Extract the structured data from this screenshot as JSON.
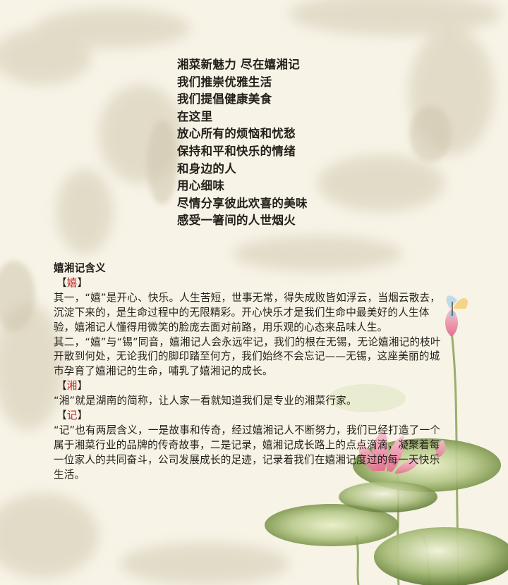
{
  "poem": {
    "lines": [
      "湘菜新魅力  尽在嬉湘记",
      "我们推崇优雅生活",
      "我们提倡健康美食",
      "在这里",
      "放心所有的烦恼和忧愁",
      "保持和平和快乐的情绪",
      "和身边的人",
      "用心细味",
      "尽情分享彼此欢喜的美味",
      "感受一箸间的人世烟火"
    ]
  },
  "article": {
    "heading": "嬉湘记含义",
    "bracket_open": "【",
    "bracket_close": "】",
    "sections": [
      {
        "key": "嬉",
        "paragraphs": [
          "其一，“嬉”是开心、快乐。人生苦短，世事无常，得失成败皆如浮云，当烟云散去，沉淀下来的，是生命过程中的无限精彩。开心快乐才是我们生命中最美好的人生体验，嬉湘记人懂得用微笑的脸庞去面对前路，用乐观的心态来品味人生。",
          "其二，“嬉”与“锡”同音，嬉湘记人会永远牢记，我们的根在无锡，无论嬉湘记的枝叶开散到何处，无论我们的脚印踏至何方，我们始终不会忘记——无锡，这座美丽的城市孕育了嬉湘记的生命，哺乳了嬉湘记的成长。"
        ]
      },
      {
        "key": "湘",
        "paragraphs": [
          "“湘”就是湖南的简称，让人家一看就知道我们是专业的湘菜行家。"
        ]
      },
      {
        "key": "记",
        "paragraphs": [
          "“记”也有两层含义，一是故事和传奇，经过嬉湘记人不断努力，我们已经打造了一个属于湘菜行业的品牌的传奇故事，二是记录，嬉湘记成长路上的点点滴滴，凝聚着每一位家人的共同奋斗，公司发展成长的足迹，记录着我们在嬉湘记度过的每一天快乐生活。"
        ]
      }
    ]
  },
  "colors": {
    "background": "#f7f3e6",
    "text": "#231f1a",
    "key_accent": "#c0282a",
    "lotus_leaf": "#8aa35a",
    "lotus_flower": "#ef9fb4"
  }
}
